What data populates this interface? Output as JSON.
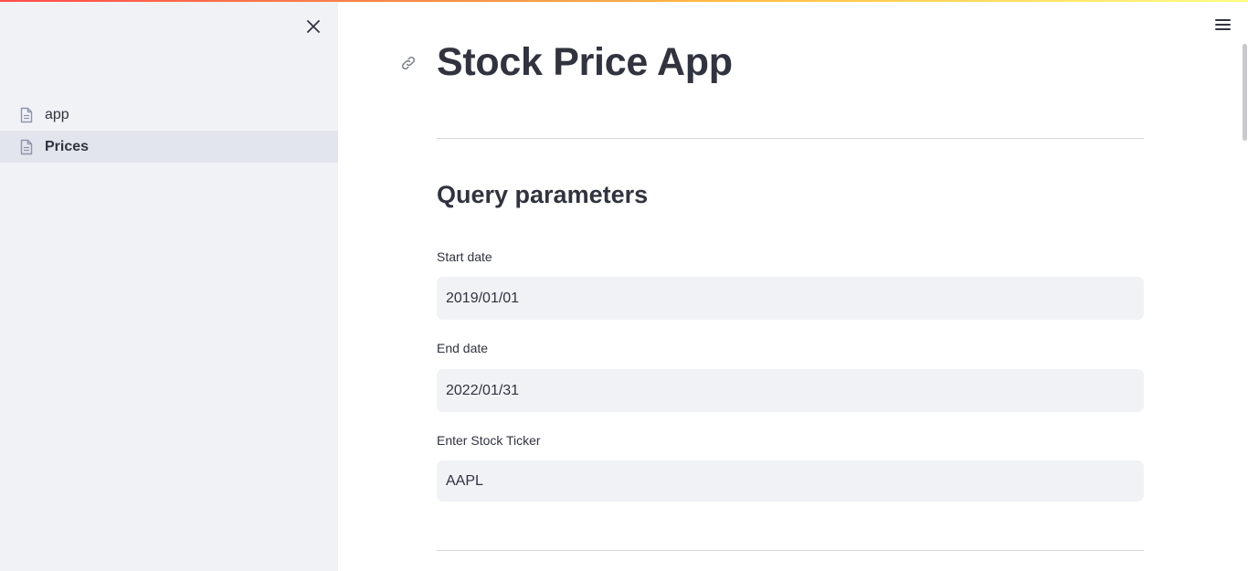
{
  "sidebar": {
    "close_icon": "close-icon",
    "items": [
      {
        "label": "app",
        "icon": "page-icon",
        "active": false
      },
      {
        "label": "Prices",
        "icon": "page-icon",
        "active": true
      }
    ]
  },
  "header": {
    "menu_icon": "hamburger-menu-icon",
    "accent_gradient": [
      "#ff4b4b",
      "#ffbd45",
      "#fffd80"
    ]
  },
  "main": {
    "title": "Stock Price App",
    "anchor_icon": "link-icon",
    "section_title": "Query parameters",
    "fields": {
      "start_date": {
        "label": "Start date",
        "value": "2019/01/01"
      },
      "end_date": {
        "label": "End date",
        "value": "2022/01/31"
      },
      "ticker": {
        "label": "Enter Stock Ticker",
        "value": "AAPL"
      }
    }
  },
  "colors": {
    "sidebar_bg": "#f0f2f6",
    "input_bg": "#f0f2f6",
    "text": "#31333f"
  }
}
